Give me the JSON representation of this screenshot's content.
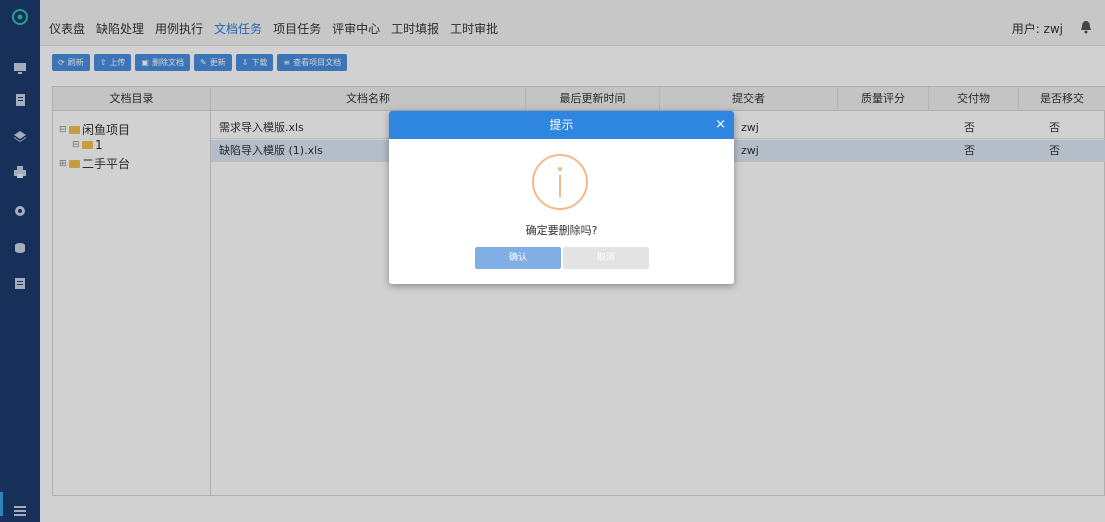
{
  "nav": {
    "items": [
      "仪表盘",
      "缺陷处理",
      "用例执行",
      "文档任务",
      "项目任务",
      "评审中心",
      "工时填报",
      "工时审批"
    ],
    "active": "文档任务"
  },
  "user": {
    "label": "用户: zwj"
  },
  "toolbar": {
    "refresh": "刷新",
    "upload": "上传",
    "delete_doc": "删除文档",
    "update": "更新",
    "download": "下载",
    "view_project_doc": "查看项目文档"
  },
  "tree": {
    "header": "文档目录",
    "nodes": [
      {
        "label": "闲鱼项目",
        "expander": "⊟"
      },
      {
        "label": "1",
        "expander": "⊟"
      },
      {
        "label": "二手平台",
        "expander": "⊞"
      }
    ]
  },
  "grid": {
    "columns": [
      "文档名称",
      "最后更新时间",
      "提交者",
      "质量评分",
      "交付物",
      "是否移交"
    ],
    "rows": [
      {
        "name": "需求导入模版.xls",
        "updated": "",
        "submitter": "zwj",
        "score": "",
        "deliverable": "否",
        "handover": "否"
      },
      {
        "name": "缺陷导入模版 (1).xls",
        "updated": "",
        "submitter": "zwj",
        "score": "",
        "deliverable": "否",
        "handover": "否"
      }
    ]
  },
  "dialog": {
    "title": "提示",
    "close": "×",
    "message": "确定要删除吗?",
    "confirm": "确认",
    "cancel": "取消"
  },
  "colors": {
    "sidebar": "#1d3b6e",
    "accent": "#2f86e0",
    "toolbar_button": "#4a8fe0",
    "info_icon": "#f2b98a",
    "selected_row": "#dde7f6"
  },
  "icons": [
    "logo-icon",
    "monitor-icon",
    "document-icon",
    "layers-icon",
    "printer-icon",
    "gear-icon",
    "database-icon",
    "clipboard-icon",
    "menu-icon",
    "bell-icon",
    "info-icon"
  ]
}
